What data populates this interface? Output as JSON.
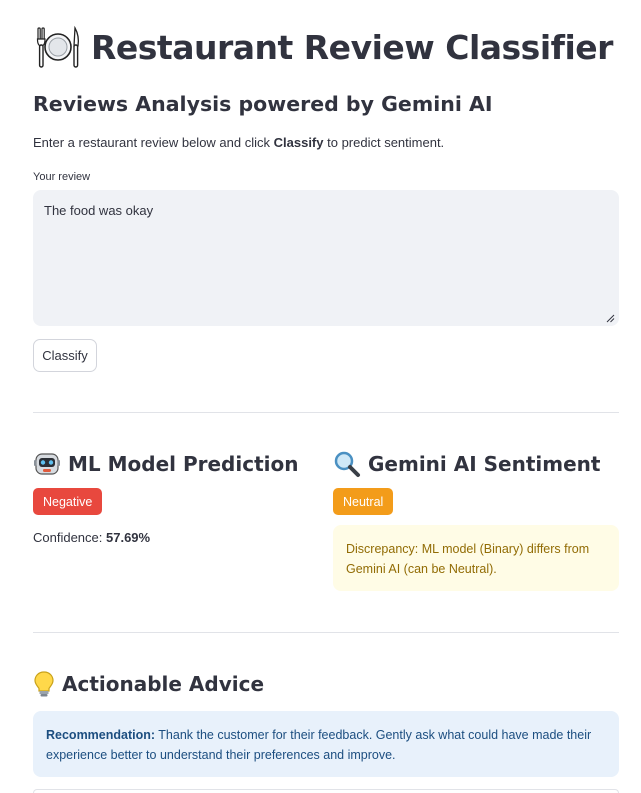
{
  "header": {
    "title_icon": "plate-fork-knife-icon",
    "title": "Restaurant Review Classifier",
    "subtitle": "Reviews Analysis powered by Gemini AI"
  },
  "intro": {
    "before": "Enter a restaurant review below and click ",
    "bold": "Classify",
    "after": " to predict sentiment."
  },
  "review": {
    "label": "Your review",
    "value": "The food was okay"
  },
  "classify_button": "Classify",
  "ml_prediction": {
    "icon": "robot-icon",
    "heading": "ML Model Prediction",
    "badge": "Negative",
    "badge_color": "#e8483e",
    "confidence_label": "Confidence: ",
    "confidence_value": "57.69%"
  },
  "gemini_sentiment": {
    "icon": "magnifier-icon",
    "heading": "Gemini AI Sentiment",
    "badge": "Neutral",
    "badge_color": "#f39c1a",
    "warning": "Discrepancy: ML model (Binary) differs from Gemini AI (can be Neutral)."
  },
  "advice": {
    "icon": "lightbulb-icon",
    "heading": "Actionable Advice",
    "recommendation_label": "Recommendation:",
    "recommendation_text": " Thank the customer for their feedback. Gently ask what could have made their experience better to understand their preferences and improve."
  }
}
